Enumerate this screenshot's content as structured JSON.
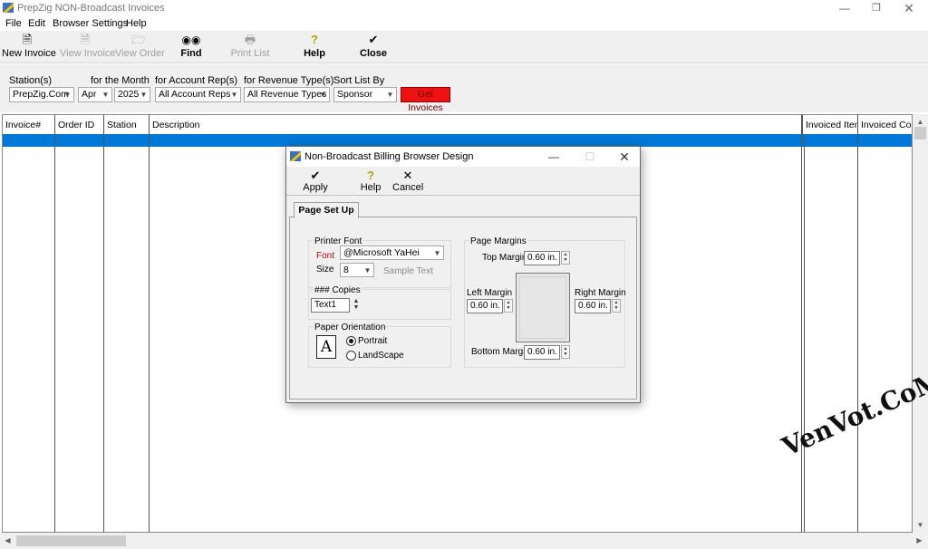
{
  "window": {
    "title": "PrepZig NON-Broadcast Invoices"
  },
  "menu": [
    "File",
    "Edit",
    "Browser Settings",
    "Help"
  ],
  "toolbar": {
    "new_invoice": "New Invoice",
    "view_invoice": "View Invoice",
    "view_order": "View Order",
    "find": "Find",
    "print_list": "Print List",
    "help": "Help",
    "close": "Close"
  },
  "filters": {
    "station_label": "Station(s)",
    "station_value": "PrepZig.Com",
    "month_label": "for the Month",
    "month_value": "Apr",
    "year_value": "2025",
    "account_label": "for Account Rep(s)",
    "account_value": "All Account Reps",
    "revenue_label": "for Revenue Type(s)",
    "revenue_value": "All Revenue Types",
    "sort_label": "Sort List By",
    "sort_value": "Sponsor",
    "get_invoices": "Get Invoices"
  },
  "grid": {
    "columns": [
      "Invoice#",
      "Order ID",
      "Station",
      "Description",
      "Invoiced Items",
      "Invoiced Cost"
    ]
  },
  "dialog": {
    "title": "Non-Broadcast Billing Browser Design",
    "apply": "Apply",
    "help": "Help",
    "cancel": "Cancel",
    "tab": "Page Set Up",
    "printer_font": "Printer Font",
    "font_label": "Font",
    "font_value": "@Microsoft YaHei",
    "size_label": "Size",
    "size_value": "8",
    "sample_text": "Sample Text",
    "copies_label": "### Copies",
    "copies_value": "Text1",
    "orientation_label": "Paper Orientation",
    "orientation_icon_letter": "A",
    "portrait": "Portrait",
    "landscape": "LandScape",
    "orientation_selected": "Portrait",
    "page_margins": "Page Margins",
    "top_margin_label": "Top Margin",
    "top_margin": "0.60 in.",
    "left_margin_label": "Left Margin",
    "left_margin": "0.60 in.",
    "right_margin_label": "Right Margin",
    "right_margin": "0.60 in.",
    "bottom_margin_label": "Bottom Margin",
    "bottom_margin": "0.60 in."
  },
  "watermark": "VenVot.CoM",
  "colors": {
    "selection": "#0078d7",
    "get_invoices_bg": "#ee1111",
    "font_label": "#a01010"
  }
}
